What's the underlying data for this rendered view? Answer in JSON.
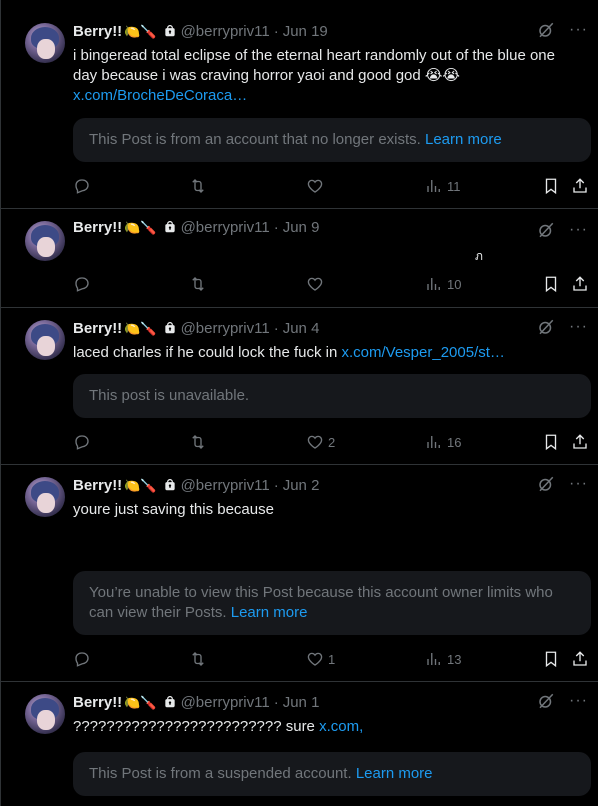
{
  "posts": [
    {
      "name": "Berry!!",
      "emojis": "🍋🪛",
      "handle": "@berrypriv11",
      "date": "Jun 19",
      "text": "i bingeread total eclipse of the eternal heart randomly out of the blue one day because i was craving horror yaoi and good god 😭😭",
      "link": "x.com/BrocheDeCoraca…",
      "quote": "This Post is from an account that no longer exists.",
      "quote_link": "Learn more",
      "likes": "",
      "views": "11"
    },
    {
      "name": "Berry!!",
      "emojis": "🍋🪛",
      "handle": "@berrypriv11",
      "date": "Jun 9",
      "text": "",
      "likes": "",
      "views": "10"
    },
    {
      "name": "Berry!!",
      "emojis": "🍋🪛",
      "handle": "@berrypriv11",
      "date": "Jun 4",
      "text": "laced charles if he could lock the fuck in",
      "link": "x.com/Vesper_2005/st…",
      "quote": "This post is unavailable.",
      "likes": "2",
      "views": "16"
    },
    {
      "name": "Berry!!",
      "emojis": "🍋🪛",
      "handle": "@berrypriv11",
      "date": "Jun 2",
      "text": "youre just saving  this because",
      "quote": "You’re unable to view this Post because this account owner limits who can view their Posts.",
      "quote_link": "Learn more",
      "likes": "1",
      "views": "13"
    },
    {
      "name": "Berry!!",
      "emojis": "🍋🪛",
      "handle": "@berrypriv11",
      "date": "Jun 1",
      "text": "????????????????????????? sure",
      "link": "x.com,",
      "quote": "This Post is from a suspended account.",
      "quote_link": "Learn more"
    }
  ],
  "colors": {
    "background": "#000000",
    "text": "#e7e9ea",
    "muted": "#71767b",
    "link": "#1d9bf0",
    "card": "#16181c",
    "divider": "#2f3336"
  },
  "icons": [
    "grok-icon",
    "more-icon",
    "lock-icon",
    "reply-icon",
    "repost-icon",
    "like-icon",
    "views-icon",
    "bookmark-icon",
    "share-icon"
  ]
}
